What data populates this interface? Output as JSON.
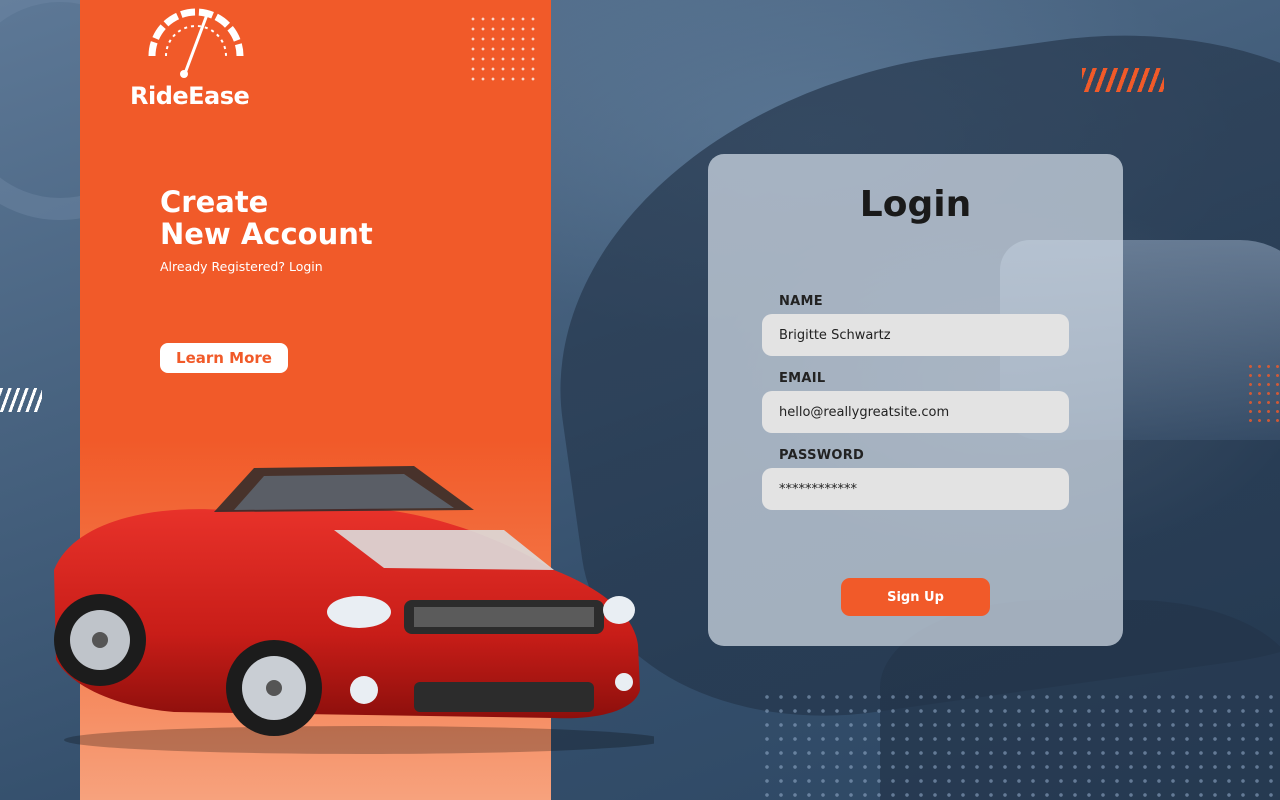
{
  "brand": {
    "name": "RideEase",
    "logo_icon": "speedometer-icon"
  },
  "hero": {
    "title_line1": "Create",
    "title_line2": "New Account",
    "subtitle": "Already Registered? Login",
    "learn_more_label": "Learn More"
  },
  "login": {
    "title": "Login",
    "name_label": "NAME",
    "name_value": "Brigitte Schwartz",
    "email_label": "EMAIL",
    "email_value": "hello@reallygreatsite.com",
    "password_label": "PASSWORD",
    "password_value": "************",
    "signup_label": "Sign Up"
  },
  "colors": {
    "accent": "#f15a29",
    "background": "#3f5a78",
    "card": "#d2dce8",
    "input": "#e3e3e3",
    "car": "#d9201c"
  }
}
